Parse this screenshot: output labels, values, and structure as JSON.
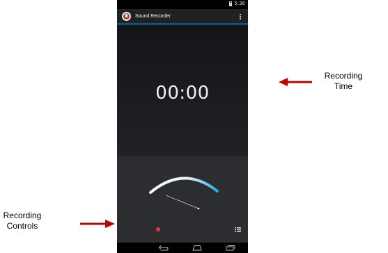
{
  "status_bar": {
    "time": "5:36",
    "battery_icon": "battery-icon"
  },
  "action_bar": {
    "title": "Sound Recorder",
    "app_icon": "microphone-icon",
    "menu_icon": "overflow-menu-icon"
  },
  "main": {
    "recording_time": "00:00"
  },
  "meter": {
    "icon": "vu-meter-gauge"
  },
  "controls": {
    "record_icon": "record-icon",
    "list_icon": "list-icon"
  },
  "nav_bar": {
    "back_icon": "back-icon",
    "home_icon": "home-icon",
    "recents_icon": "recents-icon"
  },
  "annotations": {
    "recording_time_line1": "Recording",
    "recording_time_line2": "Time",
    "recording_controls_line1": "Recording",
    "recording_controls_line2": "Controls"
  },
  "colors": {
    "accent": "#33b5e5",
    "record": "#e53935",
    "arrow": "#c00000"
  }
}
